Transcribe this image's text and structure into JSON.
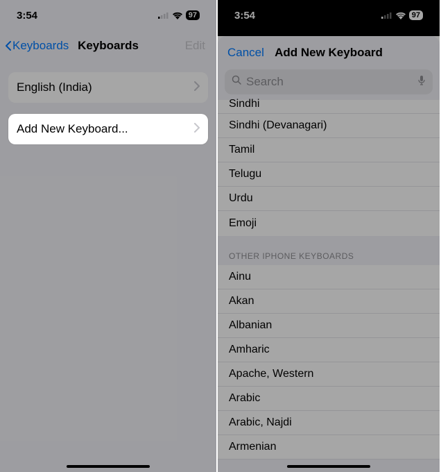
{
  "status": {
    "time": "3:54",
    "battery": "97"
  },
  "left": {
    "back_label": "Keyboards",
    "title": "Keyboards",
    "edit_label": "Edit",
    "current_keyboard": "English (India)",
    "add_new": "Add New Keyboard..."
  },
  "right": {
    "cancel": "Cancel",
    "title": "Add New Keyboard",
    "search_placeholder": "Search",
    "suggested": [
      "Sindhi",
      "Sindhi (Devanagari)",
      "Tamil",
      "Telugu",
      "Urdu",
      "Emoji"
    ],
    "section_other": "OTHER IPHONE KEYBOARDS",
    "others": [
      "Ainu",
      "Akan",
      "Albanian",
      "Amharic",
      "Apache, Western",
      "Arabic",
      "Arabic, Najdi",
      "Armenian"
    ]
  }
}
